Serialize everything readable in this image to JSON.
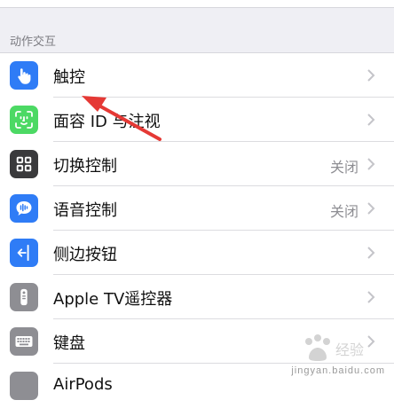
{
  "section": {
    "title": "动作交互"
  },
  "rows": [
    {
      "label": "触控",
      "value": "",
      "icon": "hand-pointer-icon",
      "color": "#2f7cf6"
    },
    {
      "label": "面容 ID 与注视",
      "value": "",
      "icon": "face-id-icon",
      "color": "#4cd964"
    },
    {
      "label": "切换控制",
      "value": "关闭",
      "icon": "switch-control-grid-icon",
      "color": "#3a3a3c"
    },
    {
      "label": "语音控制",
      "value": "关闭",
      "icon": "voice-control-icon",
      "color": "#2f7cf6"
    },
    {
      "label": "侧边按钮",
      "value": "",
      "icon": "side-button-icon",
      "color": "#2f7cf6"
    },
    {
      "label": "Apple TV遥控器",
      "value": "",
      "icon": "remote-icon",
      "color": "#8e8e93"
    },
    {
      "label": "键盘",
      "value": "",
      "icon": "keyboard-icon",
      "color": "#8e8e93"
    },
    {
      "label": "AirPods",
      "value": "",
      "icon": "airpods-icon",
      "color": "#8e8e93"
    }
  ],
  "annotation": {
    "color": "#e53935"
  },
  "watermark": {
    "text": "jingyan.baidu.com"
  }
}
